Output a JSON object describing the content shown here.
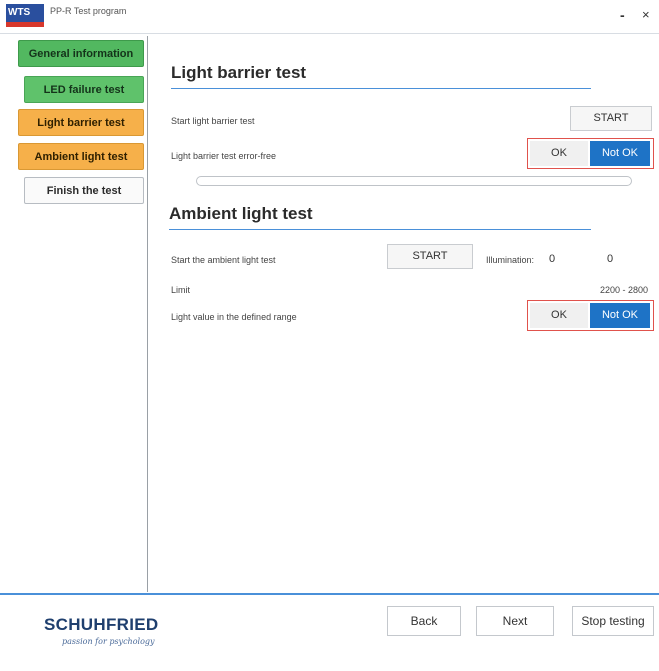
{
  "window": {
    "logo_text": "WTS",
    "title": "PP-R Test program",
    "minimize": "-",
    "close": "×"
  },
  "sidebar": {
    "items": [
      {
        "label": "General information",
        "state": "complete"
      },
      {
        "label": "LED failure test",
        "state": "complete"
      },
      {
        "label": "Light barrier test",
        "state": "active"
      },
      {
        "label": "Ambient light test",
        "state": "active"
      },
      {
        "label": "Finish the test",
        "state": "pending"
      }
    ]
  },
  "light_barrier": {
    "title": "Light barrier test",
    "start_label": "Start light barrier test",
    "start_button": "START",
    "result_label": "Light barrier test error-free",
    "ok_button": "OK",
    "notok_button": "Not OK",
    "selected": "Not OK",
    "progress_fraction": 0
  },
  "ambient": {
    "title": "Ambient light test",
    "start_label": "Start the ambient light test",
    "start_button": "START",
    "illumination_label": "Illumination:",
    "illumination_value_1": "0",
    "illumination_value_2": "0",
    "limit_label": "Limit",
    "limit_value": "2200 - 2800",
    "range_label": "Light value in the defined range",
    "ok_button": "OK",
    "notok_button": "Not OK",
    "selected": "Not OK"
  },
  "footer": {
    "brand": "SCHUHFRIED",
    "tagline": "passion for psychology",
    "back_button": "Back",
    "next_button": "Next",
    "stop_button": "Stop testing"
  },
  "colors": {
    "accent_blue": "#1e73c6",
    "complete_green": "#52b860",
    "active_orange": "#f6b04a",
    "error_outline": "#e0524c"
  }
}
